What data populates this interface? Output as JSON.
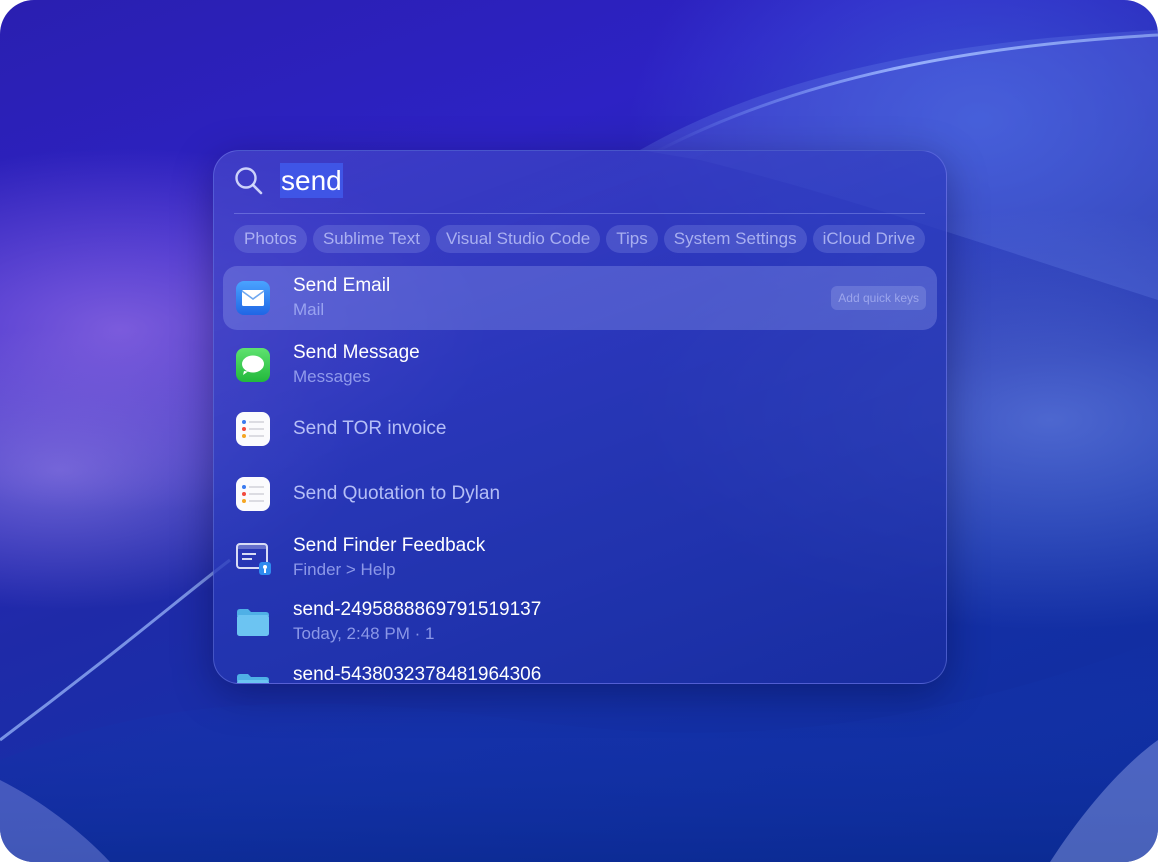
{
  "search": {
    "query": "send"
  },
  "filters": [
    {
      "label": "Photos"
    },
    {
      "label": "Sublime Text"
    },
    {
      "label": "Visual Studio Code"
    },
    {
      "label": "Tips"
    },
    {
      "label": "System Settings"
    },
    {
      "label": "iCloud Drive"
    }
  ],
  "results": [
    {
      "title": "Send Email",
      "subtitle": "Mail",
      "icon": "mail-icon",
      "selected": true,
      "action_label": "Add quick keys"
    },
    {
      "title": "Send Message",
      "subtitle": "Messages",
      "icon": "messages-icon"
    },
    {
      "title": "Send TOR invoice",
      "subtitle": "",
      "icon": "reminders-icon"
    },
    {
      "title": "Send Quotation to Dylan",
      "subtitle": "",
      "icon": "reminders-icon"
    },
    {
      "title": "Send Finder Feedback",
      "subtitle": "Finder > Help",
      "icon": "feedback-icon"
    },
    {
      "title": "send-2495888869791519137",
      "subtitle": "Today, 2:48 PM · 1",
      "icon": "folder-icon"
    },
    {
      "title": "send-5438032378481964306",
      "subtitle": "",
      "icon": "folder-icon"
    }
  ],
  "colors": {
    "selection_highlight": "#3f55e6",
    "mail_blue": "#2f7df6",
    "messages_green": "#34c759",
    "folder_blue": "#6cc4f2"
  }
}
